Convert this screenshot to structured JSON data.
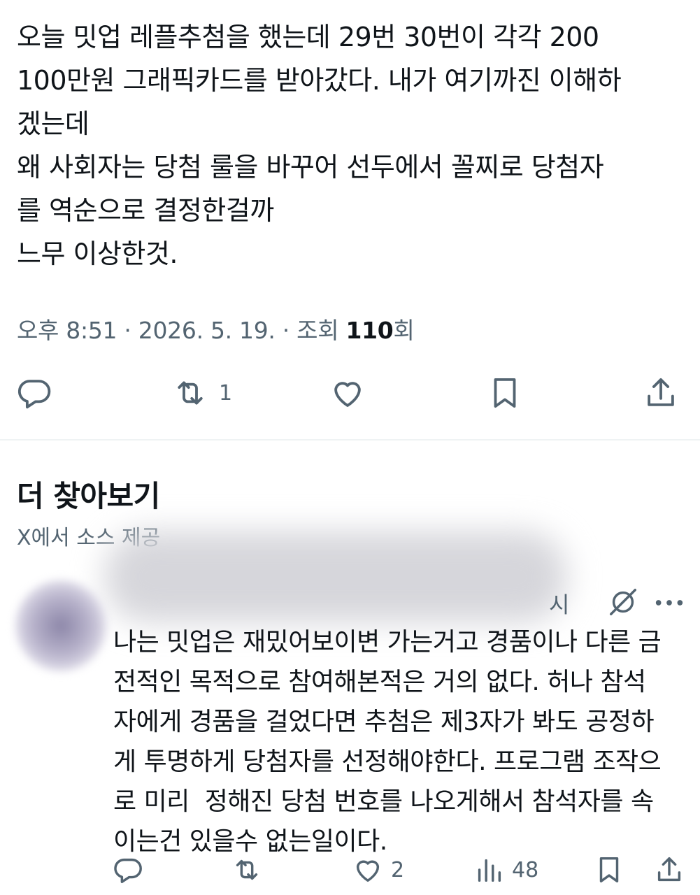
{
  "post": {
    "text": "오늘 밋업 레플추첨을 했는데 29번 30번이 각각 200\n100만원 그래픽카드를 받아갔다. 내가 여기까진 이해하\n겠는데\n왜 사회자는 당첨 룰을 바꾸어 선두에서 꼴찌로 당첨자\n를 역순으로 결정한걸까\n느무 이상한것.",
    "time": "오후 8:51 · 2026. 5. 19. · 조회 ",
    "views": "110",
    "views_suffix": "회",
    "retweet_count": "1"
  },
  "actions": {
    "reply_icon": "reply-icon",
    "retweet_icon": "retweet-icon",
    "like_icon": "heart-icon",
    "bookmark_icon": "bookmark-icon",
    "share_icon": "share-icon"
  },
  "more_section": {
    "title": "더 찾아보기",
    "subtitle": "X에서 소스 제공"
  },
  "reply": {
    "time": "시",
    "text": "나는 밋업은 재밌어보이변 가는거고 경품이나 다른 금\n전적인 목적으로 참여해본적은 거의 없다. 허나 참석\n자에게 경품을 걸었다면 추첨은 제3자가 봐도 공정하\n게 투명하게 당첨자를 선정해야한다. 프로그램 조작으\n로 미리  정해진 당첨 번호를 나오게해서 참석자를 속\n이는건 있을수 없는일이다.",
    "like_count": "2",
    "view_count": "48"
  },
  "colors": {
    "text": "#0f1419",
    "muted": "#536471",
    "divider": "#eff3f4"
  }
}
